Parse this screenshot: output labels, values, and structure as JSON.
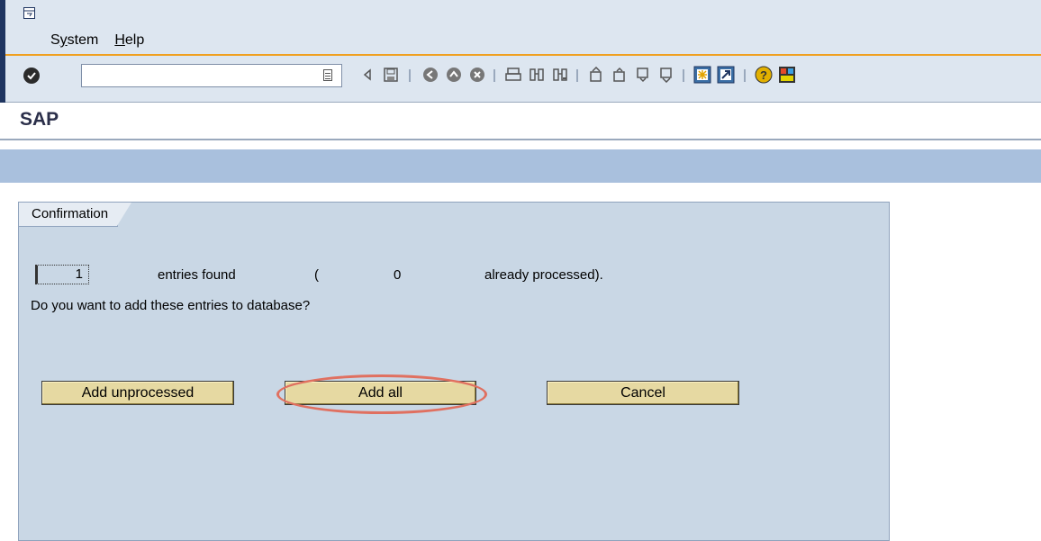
{
  "menu": {
    "items": [
      "System",
      "Help"
    ]
  },
  "command_field": {
    "value": ""
  },
  "title": "SAP",
  "confirmation": {
    "tab_label": "Confirmation",
    "count": "1",
    "entries_found_label": "entries found",
    "open_paren": "(",
    "processed_count": "0",
    "already_processed_label": "already processed).",
    "question": "Do you want to add these entries to database?"
  },
  "buttons": {
    "add_unprocessed": "Add unprocessed",
    "add_all": "Add all",
    "cancel": "Cancel"
  },
  "toolbar": {
    "icons": [
      "enter-icon",
      "back-arrow-icon",
      "save-icon",
      "back-icon",
      "exit-icon",
      "cancel-icon",
      "print-icon",
      "find-icon",
      "find-next-icon",
      "first-page-icon",
      "previous-page-icon",
      "next-page-icon",
      "last-page-icon",
      "create-session-icon",
      "shortcut-icon",
      "help-icon",
      "layout-menu-icon"
    ]
  },
  "colors": {
    "highlight": "#e07060",
    "button_bg": "#e6d9a2",
    "frame_bg": "#c9d7e5",
    "app_bar": "#a9c0dd"
  }
}
